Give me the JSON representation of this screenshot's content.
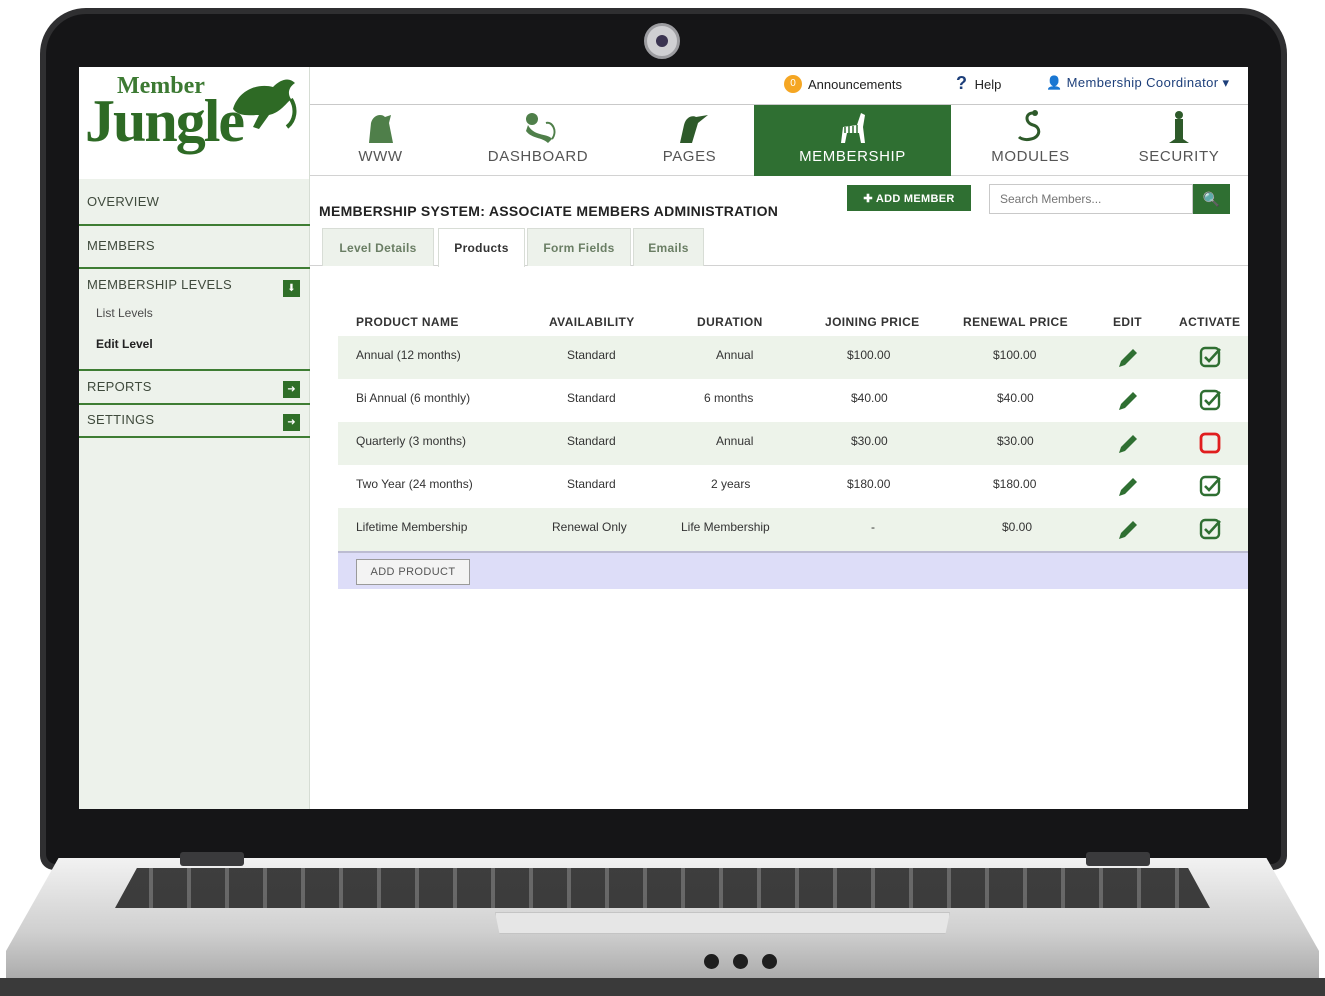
{
  "app": {
    "logo_top": "Member",
    "logo_bottom": "Jungle"
  },
  "topbar": {
    "announcements_count": "0",
    "announcements_label": "Announcements",
    "help_label": "Help",
    "user_label": "Membership Coordinator ▾"
  },
  "nav": {
    "items": [
      {
        "label": "WWW",
        "icon": "tiger-icon"
      },
      {
        "label": "DASHBOARD",
        "icon": "monkey-icon"
      },
      {
        "label": "PAGES",
        "icon": "toucan-icon"
      },
      {
        "label": "MEMBERSHIP",
        "icon": "zebra-icon"
      },
      {
        "label": "MODULES",
        "icon": "snake-icon"
      },
      {
        "label": "SECURITY",
        "icon": "meerkat-icon"
      }
    ],
    "active_color": "#2f6f32"
  },
  "sidebar": {
    "overview": "OVERVIEW",
    "members": "MEMBERS",
    "membership_levels": "MEMBERSHIP LEVELS",
    "list_levels": "List Levels",
    "edit_level": "Edit Level",
    "reports": "REPORTS",
    "settings": "SETTINGS"
  },
  "header": {
    "title": "MEMBERSHIP SYSTEM: ASSOCIATE MEMBERS ADMINISTRATION",
    "add_member": "✚ ADD MEMBER",
    "search_placeholder": "Search Members..."
  },
  "tabs": [
    "Level Details",
    "Products",
    "Form Fields",
    "Emails"
  ],
  "table": {
    "headers": [
      "PRODUCT NAME",
      "AVAILABILITY",
      "DURATION",
      "JOINING PRICE",
      "RENEWAL PRICE",
      "EDIT",
      "ACTIVATE"
    ],
    "rows": [
      {
        "name": "Annual (12 months)",
        "availability": "Standard",
        "duration": "Annual",
        "joining": "$100.00",
        "renewal": "$100.00",
        "active": true
      },
      {
        "name": "Bi Annual (6 monthly)",
        "availability": "Standard",
        "duration": "6 months",
        "joining": "$40.00",
        "renewal": "$40.00",
        "active": true
      },
      {
        "name": "Quarterly (3 months)",
        "availability": "Standard",
        "duration": "Annual",
        "joining": "$30.00",
        "renewal": "$30.00",
        "active": false
      },
      {
        "name": "Two Year (24 months)",
        "availability": "Standard",
        "duration": "2 years",
        "joining": "$180.00",
        "renewal": "$180.00",
        "active": true
      },
      {
        "name": "Lifetime Membership",
        "availability": "Renewal Only",
        "duration": "Life Membership",
        "joining": "-",
        "renewal": "$0.00",
        "active": false
      }
    ],
    "add_product": "ADD PRODUCT"
  }
}
